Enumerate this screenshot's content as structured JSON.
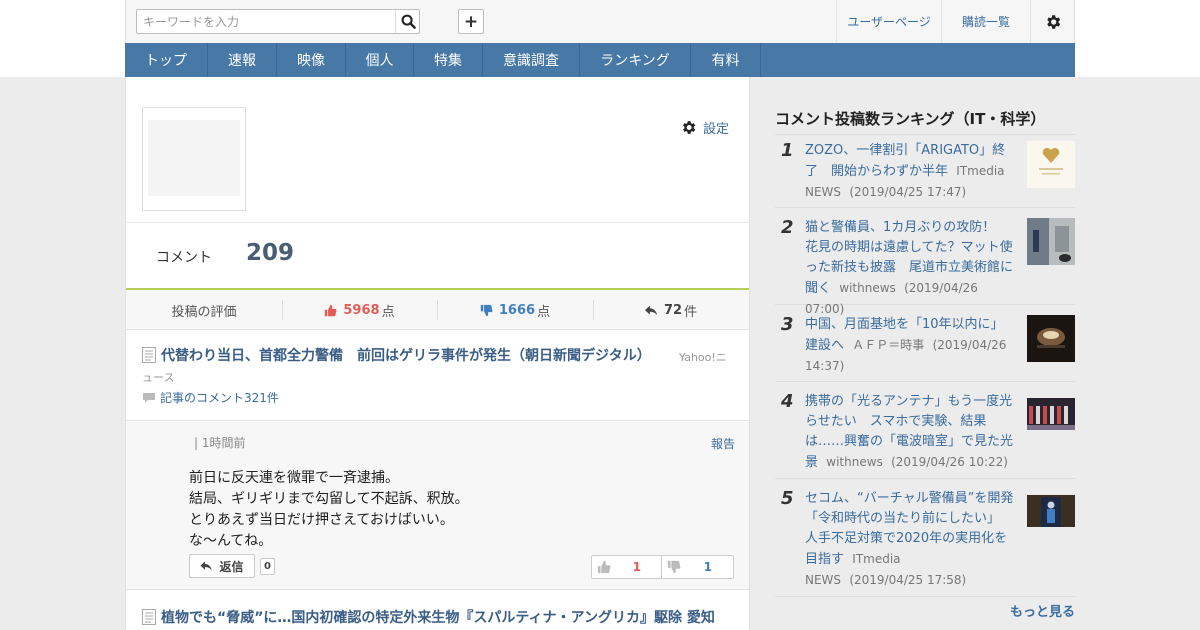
{
  "header": {
    "search_placeholder": "キーワードを入力",
    "user_page": "ユーザーページ",
    "subscriptions": "購読一覧"
  },
  "nav": [
    "トップ",
    "速報",
    "映像",
    "個人",
    "特集",
    "意識調査",
    "ランキング",
    "有料"
  ],
  "profile": {
    "settings_label": "設定",
    "comment_label": "コメント",
    "comment_count": "209"
  },
  "stats": {
    "rating_label": "投稿の評価",
    "good": "5968",
    "good_unit": "点",
    "bad": "1666",
    "bad_unit": "点",
    "replies": "72",
    "replies_unit": "件"
  },
  "article": {
    "title": "代替わり当日、首都全力警備　前回はゲリラ事件が発生（朝日新聞デジタル）",
    "source_line1": "Yahoo!ニ",
    "source_line2": "ュース",
    "comments_link": "記事のコメント321件"
  },
  "comment": {
    "time": "1時間前",
    "time_prefix": "|",
    "report": "報告",
    "lines": [
      "前日に反天連を微罪で一斉逮捕。",
      "結局、ギリギリまで勾留して不起訴、釈放。",
      "とりあえず当日だけ押さえておけばいい。",
      "な～んてね。"
    ],
    "reply_label": "返信",
    "reply_count": "0",
    "good_votes": "1",
    "bad_votes": "1"
  },
  "article2": {
    "title": "植物でも“脅威”に…国内初確認の特定外来生物『スパルティナ・アングリカ』駆除 愛知"
  },
  "sidebar": {
    "title": "コメント投稿数ランキング（IT・科学）",
    "more": "もっと見る",
    "items": [
      {
        "rank": "1",
        "title": "ZOZO、一律割引「ARIGATO」終了　開始からわずか半年",
        "source": "ITmedia NEWS",
        "date": "(2019/04/25 17:47)"
      },
      {
        "rank": "2",
        "title": "猫と警備員、1カ月ぶりの攻防！　花見の時期は遠慮してた？マット使った新技も披露　尾道市立美術館に聞く",
        "source": "withnews",
        "date": "(2019/04/26 07:00)"
      },
      {
        "rank": "3",
        "title": "中国、月面基地を「10年以内に」建設へ",
        "source": "ＡＦＰ＝時事",
        "date": "(2019/04/26 14:37)"
      },
      {
        "rank": "4",
        "title": "携帯の「光るアンテナ」もう一度光らせたい　スマホで実験、結果は……興奮の「電波暗室」で見た光景",
        "source": "withnews",
        "date": "(2019/04/26 10:22)"
      },
      {
        "rank": "5",
        "title": "セコム、“バーチャル警備員”を開発　「令和時代の当たり前にしたい」　人手不足対策で2020年の実用化を目指す",
        "source": "ITmedia NEWS",
        "date": "(2019/04/25 17:58)"
      }
    ]
  },
  "colors": {
    "nav_bg": "#4778a6",
    "link": "#3a6c9e",
    "good": "#e35d56",
    "bad": "#3f7fc2",
    "accent_line": "#b6cd5a"
  }
}
